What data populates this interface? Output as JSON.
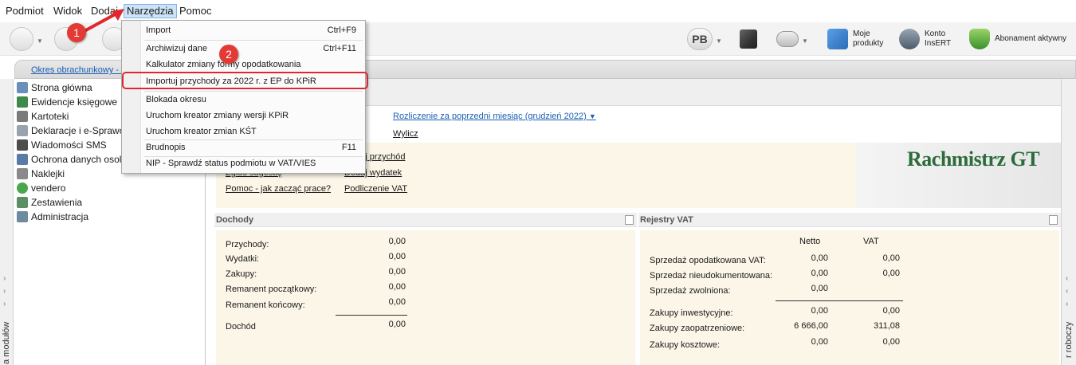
{
  "menubar": {
    "items": [
      "Podmiot",
      "Widok",
      "Dodaj",
      "Narzędzia",
      "Pomoc"
    ]
  },
  "toolbar": {
    "pb_label": "PB",
    "my_products": "Moje\nprodukty",
    "konto_l1": "Konto",
    "konto_l2": "InsERT",
    "abonament": "Abonament aktywny"
  },
  "okres": {
    "link": "Okres obrachunkowy - l"
  },
  "sidebar": {
    "vertical_label": "a modułów",
    "items": [
      {
        "label": "Strona główna",
        "icon": "home-icon"
      },
      {
        "label": "Ewidencje księgowe",
        "icon": "books-icon"
      },
      {
        "label": "Kartoteki",
        "icon": "cards-icon"
      },
      {
        "label": "Deklaracje i e-Sprawo",
        "icon": "declaration-icon"
      },
      {
        "label": "Wiadomości SMS",
        "icon": "sms-icon"
      },
      {
        "label": "Ochrona danych osol",
        "icon": "shield-icon"
      },
      {
        "label": "Naklejki",
        "icon": "sticker-icon"
      },
      {
        "label": "vendero",
        "icon": "vendero-icon"
      },
      {
        "label": "Zestawienia",
        "icon": "report-icon"
      },
      {
        "label": "Administracja",
        "icon": "admin-icon"
      }
    ]
  },
  "main": {
    "rozliczenie": "Rozliczenie za poprzedni miesiąc (grudzień 2022)",
    "wylicz": "Wylicz",
    "quick_links": {
      "zglos": "Zgłoś sugestię",
      "pomoc": "Pomoc - jak zacząć prace?",
      "przychod": "Dodaj przychód",
      "wydatek": "Dodaj wydatek",
      "vat": "Podliczenie VAT"
    },
    "logo_text": "Rachmistrz GT",
    "right_vertical": "r roboczy"
  },
  "dochody": {
    "title": "Dochody",
    "rows": [
      {
        "label": "Przychody:",
        "value": "0,00"
      },
      {
        "label": "Wydatki:",
        "value": "0,00"
      },
      {
        "label": "Zakupy:",
        "value": "0,00"
      },
      {
        "label": "Remanent początkowy:",
        "value": "0,00"
      },
      {
        "label": "Remanent końcowy:",
        "value": "0,00"
      }
    ],
    "total_label": "Dochód",
    "total_value": "0,00"
  },
  "vat": {
    "title": "Rejestry VAT",
    "col_netto": "Netto",
    "col_vat": "VAT",
    "rows_a": [
      {
        "label": "Sprzedaż opodatkowana VAT:",
        "netto": "0,00",
        "vat": "0,00"
      },
      {
        "label": "Sprzedaż nieudokumentowana:",
        "netto": "0,00",
        "vat": "0,00"
      },
      {
        "label": "Sprzedaż zwolniona:",
        "netto": "0,00",
        "vat": ""
      }
    ],
    "rows_b": [
      {
        "label": "Zakupy inwestycyjne:",
        "netto": "0,00",
        "vat": "0,00"
      },
      {
        "label": "Zakupy zaopatrzeniowe:",
        "netto": "6 666,00",
        "vat": "311,08"
      },
      {
        "label": "Zakupy kosztowe:",
        "netto": "0,00",
        "vat": "0,00"
      }
    ]
  },
  "dropdown": {
    "items": [
      {
        "label": "Import",
        "shortcut": "Ctrl+F9"
      },
      {
        "label": "Archiwizuj dane",
        "shortcut": "Ctrl+F11"
      },
      {
        "label": "Kalkulator zmiany formy opodatkowania",
        "shortcut": ""
      },
      {
        "label": "Importuj przychody za 2022 r. z EP do KPiR",
        "shortcut": ""
      },
      {
        "label": "Blokada okresu",
        "shortcut": ""
      },
      {
        "label": "Uruchom kreator zmiany wersji KPiR",
        "shortcut": ""
      },
      {
        "label": "Uruchom kreator zmian KŚT",
        "shortcut": ""
      },
      {
        "label": "Brudnopis",
        "shortcut": "F11"
      },
      {
        "label": "NIP - Sprawdź status podmiotu w VAT/VIES",
        "shortcut": ""
      }
    ]
  },
  "annotations": {
    "badge1": "1",
    "badge2": "2",
    "accent": "#e33a35"
  }
}
